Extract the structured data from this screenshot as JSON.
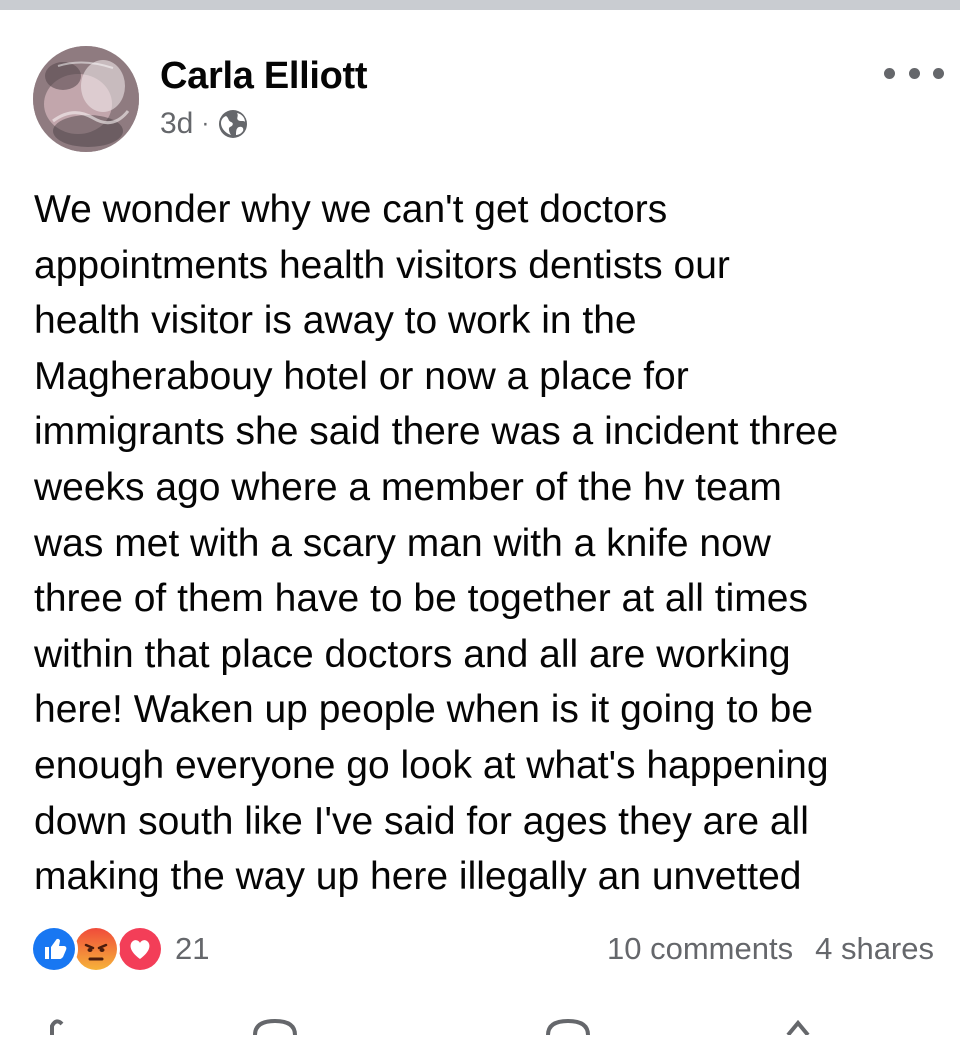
{
  "post": {
    "author": "Carla Elliott",
    "time": "3d",
    "separator": "·",
    "privacy_icon": "globe-icon",
    "more_icon": "more-horizontal-icon",
    "text_lines": [
      "We wonder why we can't get doctors",
      "appointments health visitors dentists our",
      "health visitor is away to work in the",
      "Magherabouy hotel or now a place for",
      "immigrants she said there was a incident three",
      "weeks ago where a member of the hv team",
      "was met with a scary man with a knife now",
      "three of them have to be together at all times",
      "within that place doctors and all are working",
      "here! Waken up people when is it going to be",
      "enough everyone go look at what's happening",
      "down south like I've said for ages they are all",
      "making the way up here illegally an unvetted"
    ]
  },
  "reactions": {
    "icons": [
      "like-icon",
      "angry-icon",
      "love-icon"
    ],
    "count": "21"
  },
  "stats": {
    "comments": "10 comments",
    "shares": "4 shares"
  },
  "colors": {
    "like": "#1877f2",
    "love": "#f33e58",
    "angry": "#f04b3a",
    "secondary_text": "#65676b",
    "top_strip": "#c9ccd1"
  }
}
